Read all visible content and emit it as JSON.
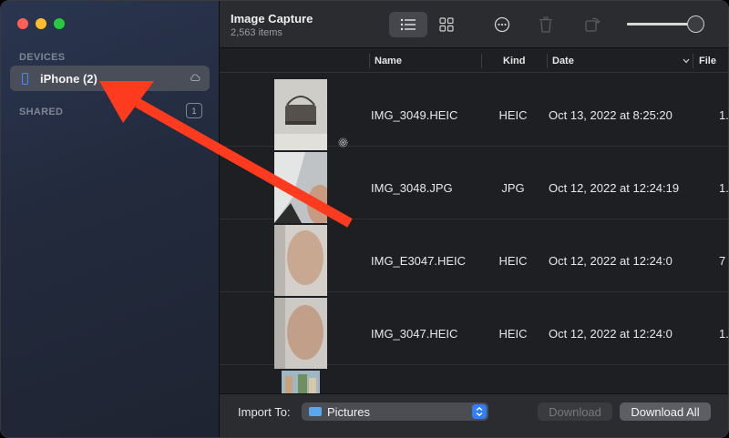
{
  "window": {
    "title": "Image Capture",
    "item_count": "2,563 items"
  },
  "sidebar": {
    "devices_label": "DEVICES",
    "shared_label": "SHARED",
    "shared_count": "1",
    "items": [
      {
        "label": "iPhone (2)",
        "icon": "iphone-icon",
        "selected": true
      }
    ]
  },
  "toolbar": {
    "view_list": "list-view-icon",
    "view_grid": "grid-view-icon",
    "more": "ellipsis-icon",
    "delete": "trash-icon",
    "rotate": "rotate-icon",
    "thumbnail_size": 0.9
  },
  "table": {
    "columns": [
      "Name",
      "Kind",
      "Date",
      "File"
    ],
    "rows": [
      {
        "name": "IMG_3049.HEIC",
        "kind": "HEIC",
        "date": "Oct 13, 2022 at 8:25:20",
        "file": "1."
      },
      {
        "name": "IMG_3048.JPG",
        "kind": "JPG",
        "date": "Oct 12, 2022 at 12:24:19",
        "file": "1."
      },
      {
        "name": "IMG_E3047.HEIC",
        "kind": "HEIC",
        "date": "Oct 12, 2022 at 12:24:0",
        "file": "7"
      },
      {
        "name": "IMG_3047.HEIC",
        "kind": "HEIC",
        "date": "Oct 12, 2022 at 12:24:0",
        "file": "1."
      }
    ]
  },
  "bottom": {
    "import_label": "Import To:",
    "destination": "Pictures",
    "download": "Download",
    "download_all": "Download All"
  },
  "colors": {
    "accent": "#2f7ff5",
    "arrow": "#ff3b1f",
    "sidebar_selection": "#4a4e58"
  }
}
